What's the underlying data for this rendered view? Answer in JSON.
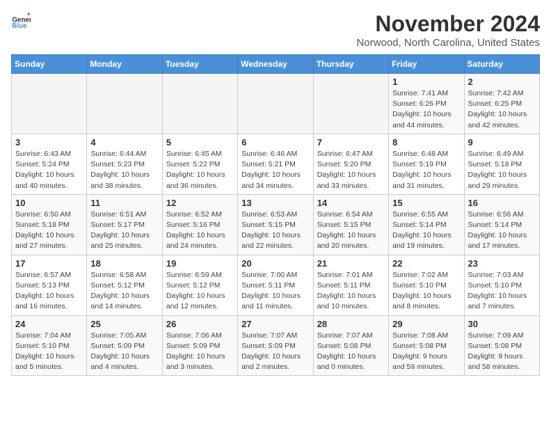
{
  "header": {
    "logo_general": "General",
    "logo_blue": "Blue",
    "month": "November 2024",
    "location": "Norwood, North Carolina, United States"
  },
  "weekdays": [
    "Sunday",
    "Monday",
    "Tuesday",
    "Wednesday",
    "Thursday",
    "Friday",
    "Saturday"
  ],
  "weeks": [
    [
      {
        "day": "",
        "detail": ""
      },
      {
        "day": "",
        "detail": ""
      },
      {
        "day": "",
        "detail": ""
      },
      {
        "day": "",
        "detail": ""
      },
      {
        "day": "",
        "detail": ""
      },
      {
        "day": "1",
        "detail": "Sunrise: 7:41 AM\nSunset: 6:26 PM\nDaylight: 10 hours\nand 44 minutes."
      },
      {
        "day": "2",
        "detail": "Sunrise: 7:42 AM\nSunset: 6:25 PM\nDaylight: 10 hours\nand 42 minutes."
      }
    ],
    [
      {
        "day": "3",
        "detail": "Sunrise: 6:43 AM\nSunset: 5:24 PM\nDaylight: 10 hours\nand 40 minutes."
      },
      {
        "day": "4",
        "detail": "Sunrise: 6:44 AM\nSunset: 5:23 PM\nDaylight: 10 hours\nand 38 minutes."
      },
      {
        "day": "5",
        "detail": "Sunrise: 6:45 AM\nSunset: 5:22 PM\nDaylight: 10 hours\nand 36 minutes."
      },
      {
        "day": "6",
        "detail": "Sunrise: 6:46 AM\nSunset: 5:21 PM\nDaylight: 10 hours\nand 34 minutes."
      },
      {
        "day": "7",
        "detail": "Sunrise: 6:47 AM\nSunset: 5:20 PM\nDaylight: 10 hours\nand 33 minutes."
      },
      {
        "day": "8",
        "detail": "Sunrise: 6:48 AM\nSunset: 5:19 PM\nDaylight: 10 hours\nand 31 minutes."
      },
      {
        "day": "9",
        "detail": "Sunrise: 6:49 AM\nSunset: 5:18 PM\nDaylight: 10 hours\nand 29 minutes."
      }
    ],
    [
      {
        "day": "10",
        "detail": "Sunrise: 6:50 AM\nSunset: 5:18 PM\nDaylight: 10 hours\nand 27 minutes."
      },
      {
        "day": "11",
        "detail": "Sunrise: 6:51 AM\nSunset: 5:17 PM\nDaylight: 10 hours\nand 25 minutes."
      },
      {
        "day": "12",
        "detail": "Sunrise: 6:52 AM\nSunset: 5:16 PM\nDaylight: 10 hours\nand 24 minutes."
      },
      {
        "day": "13",
        "detail": "Sunrise: 6:53 AM\nSunset: 5:15 PM\nDaylight: 10 hours\nand 22 minutes."
      },
      {
        "day": "14",
        "detail": "Sunrise: 6:54 AM\nSunset: 5:15 PM\nDaylight: 10 hours\nand 20 minutes."
      },
      {
        "day": "15",
        "detail": "Sunrise: 6:55 AM\nSunset: 5:14 PM\nDaylight: 10 hours\nand 19 minutes."
      },
      {
        "day": "16",
        "detail": "Sunrise: 6:56 AM\nSunset: 5:14 PM\nDaylight: 10 hours\nand 17 minutes."
      }
    ],
    [
      {
        "day": "17",
        "detail": "Sunrise: 6:57 AM\nSunset: 5:13 PM\nDaylight: 10 hours\nand 16 minutes."
      },
      {
        "day": "18",
        "detail": "Sunrise: 6:58 AM\nSunset: 5:12 PM\nDaylight: 10 hours\nand 14 minutes."
      },
      {
        "day": "19",
        "detail": "Sunrise: 6:59 AM\nSunset: 5:12 PM\nDaylight: 10 hours\nand 12 minutes."
      },
      {
        "day": "20",
        "detail": "Sunrise: 7:00 AM\nSunset: 5:11 PM\nDaylight: 10 hours\nand 11 minutes."
      },
      {
        "day": "21",
        "detail": "Sunrise: 7:01 AM\nSunset: 5:11 PM\nDaylight: 10 hours\nand 10 minutes."
      },
      {
        "day": "22",
        "detail": "Sunrise: 7:02 AM\nSunset: 5:10 PM\nDaylight: 10 hours\nand 8 minutes."
      },
      {
        "day": "23",
        "detail": "Sunrise: 7:03 AM\nSunset: 5:10 PM\nDaylight: 10 hours\nand 7 minutes."
      }
    ],
    [
      {
        "day": "24",
        "detail": "Sunrise: 7:04 AM\nSunset: 5:10 PM\nDaylight: 10 hours\nand 5 minutes."
      },
      {
        "day": "25",
        "detail": "Sunrise: 7:05 AM\nSunset: 5:09 PM\nDaylight: 10 hours\nand 4 minutes."
      },
      {
        "day": "26",
        "detail": "Sunrise: 7:06 AM\nSunset: 5:09 PM\nDaylight: 10 hours\nand 3 minutes."
      },
      {
        "day": "27",
        "detail": "Sunrise: 7:07 AM\nSunset: 5:09 PM\nDaylight: 10 hours\nand 2 minutes."
      },
      {
        "day": "28",
        "detail": "Sunrise: 7:07 AM\nSunset: 5:08 PM\nDaylight: 10 hours\nand 0 minutes."
      },
      {
        "day": "29",
        "detail": "Sunrise: 7:08 AM\nSunset: 5:08 PM\nDaylight: 9 hours\nand 59 minutes."
      },
      {
        "day": "30",
        "detail": "Sunrise: 7:09 AM\nSunset: 5:08 PM\nDaylight: 9 hours\nand 58 minutes."
      }
    ]
  ]
}
